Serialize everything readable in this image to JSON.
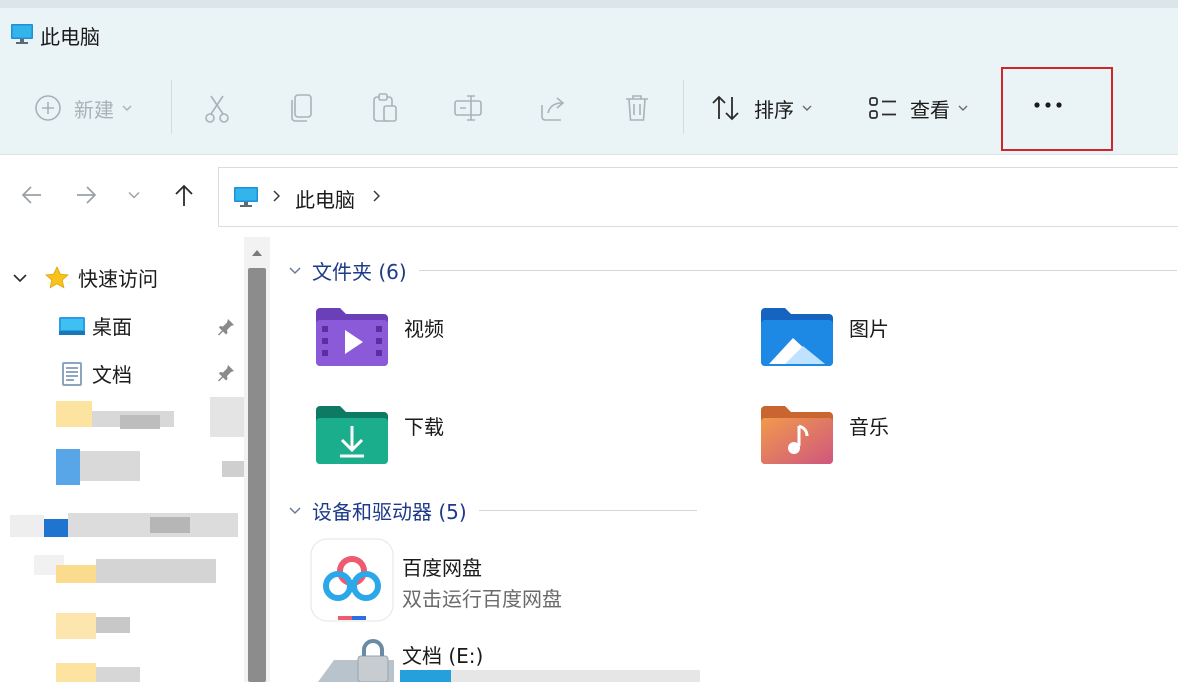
{
  "window": {
    "title": "此电脑"
  },
  "toolbar": {
    "new_label": "新建",
    "cut": "cut",
    "copy": "copy",
    "paste": "paste",
    "rename": "rename",
    "share": "share",
    "delete": "delete",
    "sort_label": "排序",
    "view_label": "查看",
    "more": "more"
  },
  "address": {
    "location": "此电脑"
  },
  "sidebar": {
    "quick_access": "快速访问",
    "items": [
      {
        "label": "桌面",
        "icon": "desktop-icon",
        "pinned": true
      },
      {
        "label": "文档",
        "icon": "document-icon",
        "pinned": true
      }
    ]
  },
  "content": {
    "folders_header": "文件夹 (6)",
    "folders": [
      {
        "name": "视频",
        "icon": "video-folder-icon",
        "color": "#7b4fd0"
      },
      {
        "name": "图片",
        "icon": "pictures-folder-icon",
        "color": "#1e88e5"
      },
      {
        "name": "下载",
        "icon": "downloads-folder-icon",
        "color": "#19a085"
      },
      {
        "name": "音乐",
        "icon": "music-folder-icon",
        "color": "#e0734a"
      }
    ],
    "devices_header": "设备和驱动器 (5)",
    "devices": [
      {
        "name": "百度网盘",
        "sub": "双击运行百度网盘",
        "icon": "baidu-netdisk-icon"
      },
      {
        "name": "文档 (E:)",
        "icon": "locked-drive-icon",
        "usage": 0.17
      }
    ]
  },
  "colors": {
    "accent": "#26a0da",
    "highlight": "#d0262b",
    "group_header": "#1e3a8a"
  }
}
